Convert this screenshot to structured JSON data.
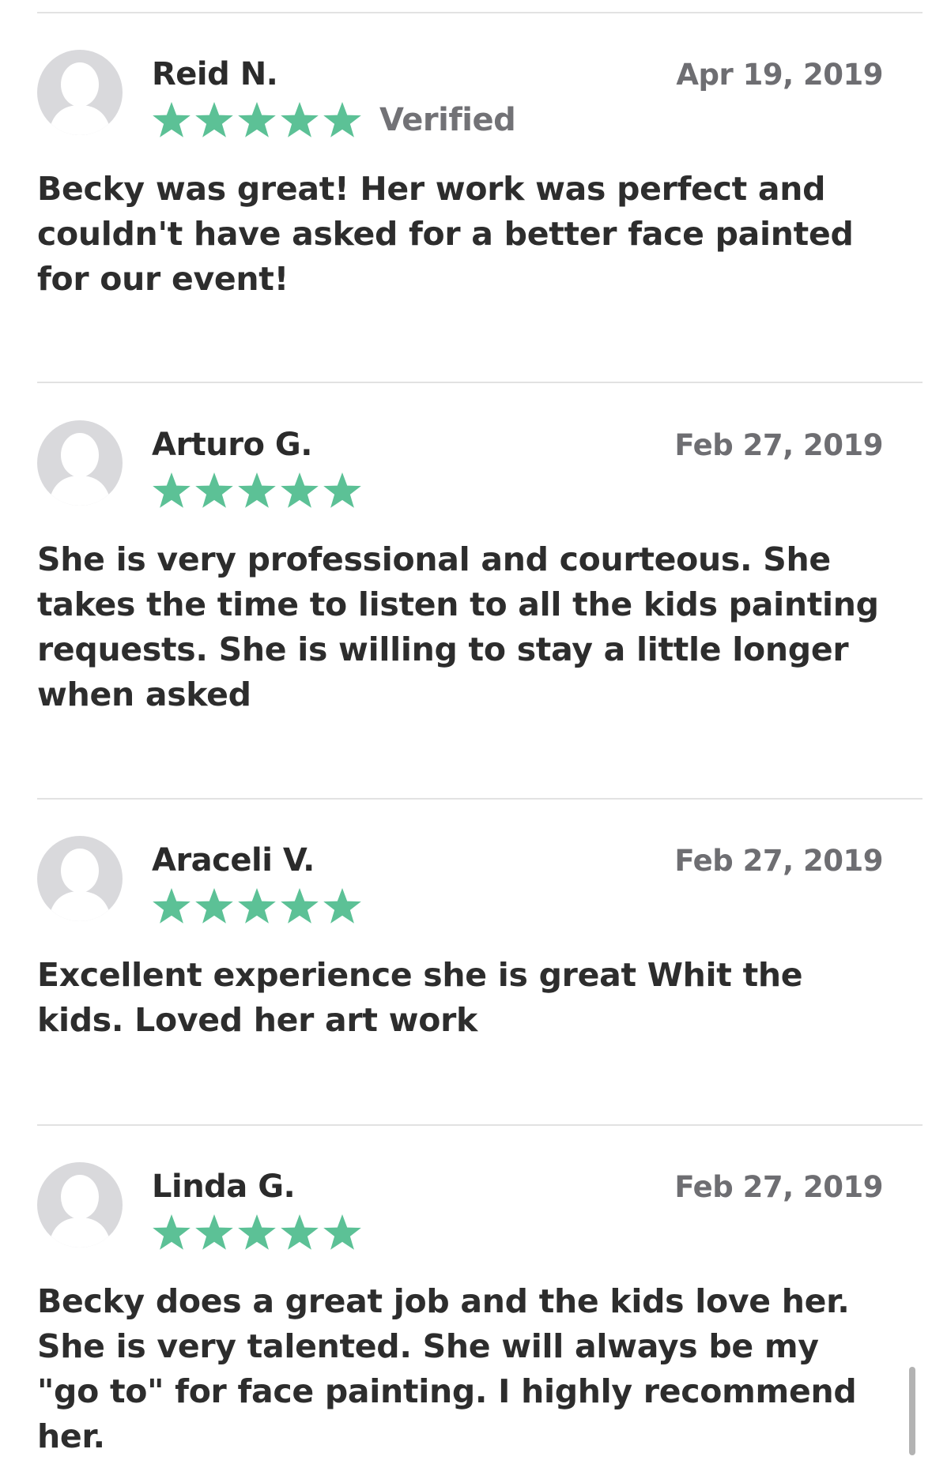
{
  "colors": {
    "star": "#5cc196",
    "avatar_bg": "#d9d9dc",
    "avatar_fg": "#ffffff"
  },
  "reviews": [
    {
      "name": "Reid N.",
      "date": "Apr 19, 2019",
      "rating": 5,
      "verified": "Verified",
      "text": "Becky was great! Her work was perfect and couldn't have asked for a better face painted for our event!"
    },
    {
      "name": "Arturo G.",
      "date": "Feb 27, 2019",
      "rating": 5,
      "verified": "",
      "text": "She is very professional and courteous. She takes the time to listen to all the kids painting requests. She is willing to stay a little longer when asked"
    },
    {
      "name": "Araceli V.",
      "date": "Feb 27, 2019",
      "rating": 5,
      "verified": "",
      "text": "Excellent experience she is great Whit the kids. Loved her art work"
    },
    {
      "name": "Linda G.",
      "date": "Feb 27, 2019",
      "rating": 5,
      "verified": "",
      "text": "Becky does a great job and the kids love her. She is very talented. She will always be my \"go to\" for face painting. I highly recommend her."
    }
  ]
}
